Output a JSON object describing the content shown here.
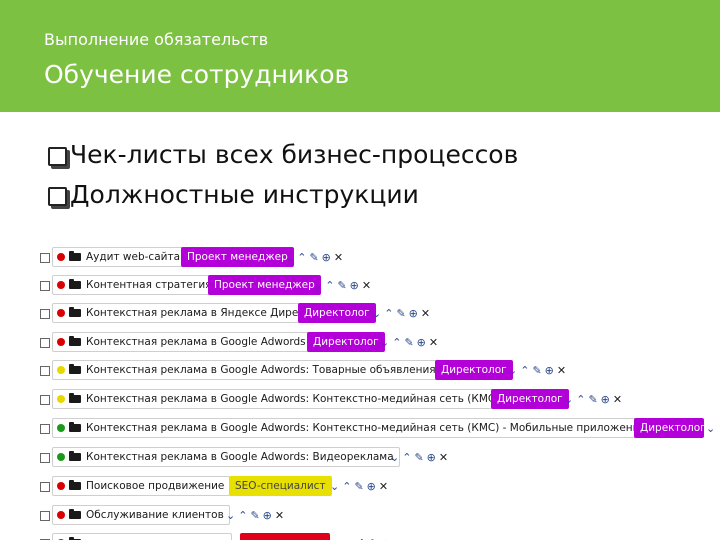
{
  "header": {
    "subtitle": "Выполнение обязательств",
    "title": "Обучение сотрудников"
  },
  "bullets": [
    "Чек-листы всех бизнес-процессов",
    "Должностные инструкции"
  ],
  "tasks": [
    {
      "name": "Аудит web-сайта",
      "tag": "Проект менеджер",
      "dot": "#d80000"
    },
    {
      "name": "Контентная стратегия",
      "tag": "Проект менеджер",
      "dot": "#d80000"
    },
    {
      "name": "Контекстная реклама в Яндексе Директ",
      "tag": "Директолог",
      "dot": "#d80000"
    },
    {
      "name": "Контекстная реклама в Google Adwords",
      "tag": "Директолог",
      "dot": "#d80000"
    },
    {
      "name": "Контекстная реклама в Google Adwords: Товарные объявления",
      "tag": "Директолог",
      "dot": "#e8d800"
    },
    {
      "name": "Контекстная реклама в Google Adwords: Контекстно-медийная сеть (КМС)",
      "tag": "Директолог",
      "dot": "#e8d800"
    },
    {
      "name": "Контекстная реклама в Google Adwords: Контекстно-медийная сеть (КМС) - Мобильные приложения",
      "tag": "Директолог",
      "dot": "#1a9a1a"
    },
    {
      "name": "Контекстная реклама в Google Adwords: Видеореклама",
      "tag": "",
      "dot": "#1a9a1a"
    },
    {
      "name": "Поисковое продвижение",
      "tag": "SEO-специалист",
      "dot": "#d80000"
    },
    {
      "name": "Обслуживание клиентов",
      "tag": "",
      "dot": "#d80000"
    },
    {
      "name": "",
      "tag": "",
      "dot": "#d80000"
    }
  ],
  "colors": {
    "header_bg": "#7dc142",
    "tag_purple": "#b400d8",
    "tag_yellow": "#e8e000",
    "tag_red": "#e0001a"
  },
  "icons": [
    "checkbox-icon",
    "status-dot-icon",
    "folder-icon",
    "chevron-down-icon",
    "chevron-up-icon",
    "edit-icon",
    "add-icon",
    "close-icon"
  ]
}
